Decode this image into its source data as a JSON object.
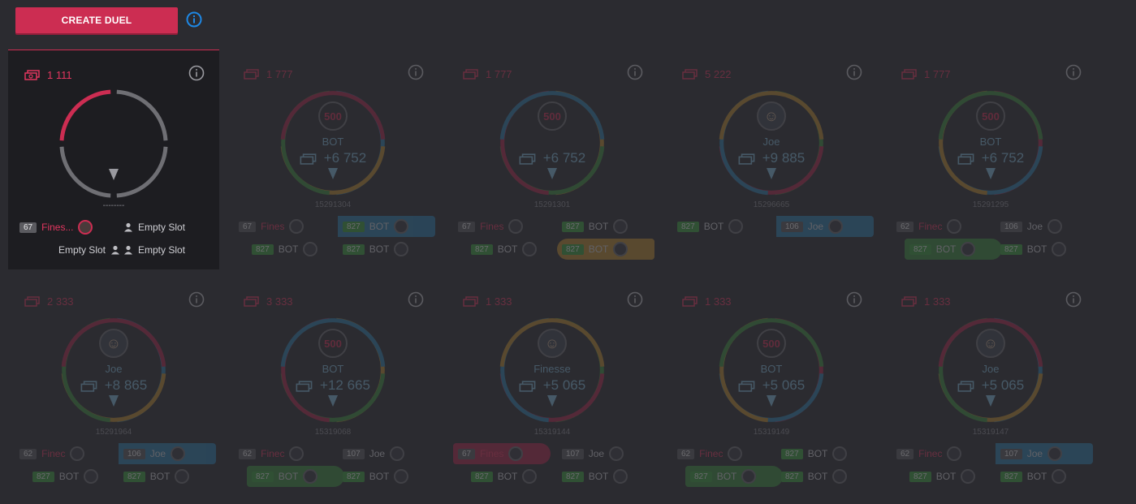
{
  "header": {
    "create_label": "CREATE DUEL"
  },
  "colors": {
    "accent": "#cc2d52",
    "info": "#1e88e5",
    "blue": "#2b7aa8",
    "gold": "#b8862e",
    "green": "#3d8a3d"
  },
  "active_duel": {
    "price": "1 111",
    "dashes": "--------",
    "slots": [
      {
        "level": "67",
        "name": "Fines..."
      },
      {
        "name": "Empty Slot"
      },
      {
        "name": "Empty Slot"
      },
      {
        "name": "Empty Slot"
      }
    ]
  },
  "duels": [
    {
      "price": "1 777",
      "winner": "BOT",
      "prize": "+6 752",
      "seed": "15291304",
      "slots": [
        {
          "level": "67",
          "name": "Fines"
        },
        {
          "level": "827",
          "name": "BOT",
          "hl": "blue"
        },
        {
          "level": "827",
          "name": "BOT"
        },
        {
          "level": "827",
          "name": "BOT"
        }
      ]
    },
    {
      "price": "1 777",
      "winner": "",
      "prize": "+6 752",
      "seed": "15291301",
      "slots": [
        {
          "level": "67",
          "name": "Fines"
        },
        {
          "level": "827",
          "name": "BOT"
        },
        {
          "level": "827",
          "name": "BOT"
        },
        {
          "level": "827",
          "name": "BOT",
          "hl": "gold"
        }
      ]
    },
    {
      "price": "5 222",
      "winner": "Joe",
      "prize": "+9 885",
      "seed": "15296665",
      "slots": [
        {
          "level": "827",
          "name": "BOT"
        },
        {
          "level": "106",
          "name": "Joe",
          "hl": "blue"
        }
      ]
    },
    {
      "price": "1 777",
      "winner": "BOT",
      "prize": "+6 752",
      "seed": "15291295",
      "slots": [
        {
          "level": "62",
          "name": "Finec"
        },
        {
          "level": "106",
          "name": "Joe"
        },
        {
          "level": "827",
          "name": "BOT",
          "hl": "green"
        },
        {
          "level": "827",
          "name": "BOT"
        }
      ]
    },
    {
      "price": "2 333",
      "winner": "Joe",
      "prize": "+8 865",
      "seed": "15291964",
      "slots": [
        {
          "level": "62",
          "name": "Finec"
        },
        {
          "level": "106",
          "name": "Joe",
          "hl": "blue"
        },
        {
          "level": "827",
          "name": "BOT"
        },
        {
          "level": "827",
          "name": "BOT"
        }
      ]
    },
    {
      "price": "3 333",
      "winner": "BOT",
      "prize": "+12 665",
      "seed": "15319068",
      "slots": [
        {
          "level": "62",
          "name": "Finec"
        },
        {
          "level": "107",
          "name": "Joe"
        },
        {
          "level": "827",
          "name": "BOT",
          "hl": "green"
        },
        {
          "level": "827",
          "name": "BOT"
        }
      ]
    },
    {
      "price": "1 333",
      "winner": "Finesse",
      "prize": "+5 065",
      "seed": "15319144",
      "slots": [
        {
          "level": "67",
          "name": "Fines",
          "hl": "red"
        },
        {
          "level": "107",
          "name": "Joe"
        },
        {
          "level": "827",
          "name": "BOT"
        },
        {
          "level": "827",
          "name": "BOT"
        }
      ]
    },
    {
      "price": "1 333",
      "winner": "BOT",
      "prize": "+5 065",
      "seed": "15319149",
      "slots": [
        {
          "level": "62",
          "name": "Finec"
        },
        {
          "level": "827",
          "name": "BOT"
        },
        {
          "level": "827",
          "name": "BOT",
          "hl": "green"
        },
        {
          "level": "827",
          "name": "BOT"
        }
      ]
    },
    {
      "price": "1 333",
      "winner": "Joe",
      "prize": "+5 065",
      "seed": "15319147",
      "slots": [
        {
          "level": "62",
          "name": "Finec"
        },
        {
          "level": "107",
          "name": "Joe",
          "hl": "blue"
        },
        {
          "level": "827",
          "name": "BOT"
        },
        {
          "level": "827",
          "name": "BOT"
        }
      ]
    }
  ]
}
